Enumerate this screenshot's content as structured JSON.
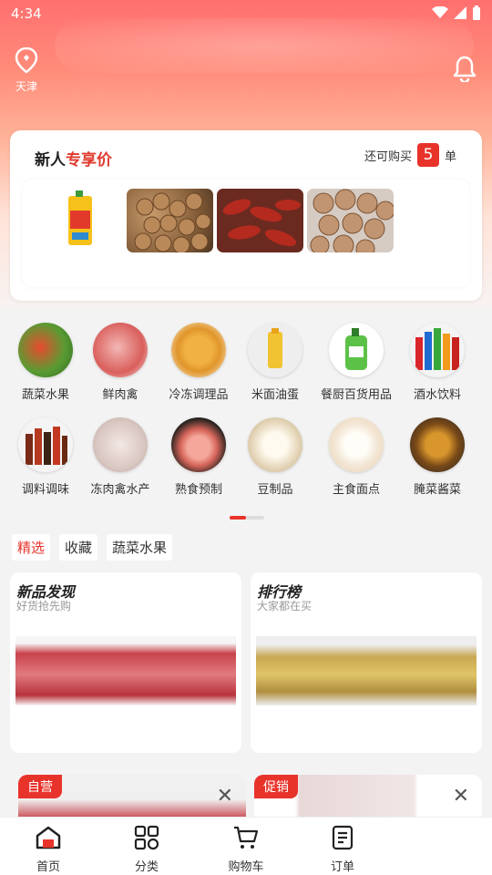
{
  "status": {
    "time": "4:34"
  },
  "header": {
    "location": "天津",
    "location_icon": "location-pin-icon",
    "bell_icon": "bell-icon"
  },
  "new_user": {
    "title_black": "新人",
    "title_red": "专享价",
    "remaining_prefix": "还可购买",
    "remaining_count": "5",
    "remaining_suffix": "单",
    "products": [
      "oil-jug",
      "dried-fruit",
      "red-chili",
      "walnut"
    ]
  },
  "categories": [
    {
      "label": "蔬菜水果"
    },
    {
      "label": "鲜肉禽"
    },
    {
      "label": "冷冻调理品"
    },
    {
      "label": "米面油蛋"
    },
    {
      "label": "餐厨百货用品"
    },
    {
      "label": "酒水饮料"
    },
    {
      "label": "调料调味"
    },
    {
      "label": "冻肉禽水产"
    },
    {
      "label": "熟食预制"
    },
    {
      "label": "豆制品"
    },
    {
      "label": "主食面点"
    },
    {
      "label": "腌菜酱菜"
    }
  ],
  "tabs": [
    {
      "label": "精选",
      "active": true
    },
    {
      "label": "收藏"
    },
    {
      "label": "蔬菜水果"
    }
  ],
  "features": [
    {
      "title": "新品发现",
      "subtitle": "好货抢先购"
    },
    {
      "title": "排行榜",
      "subtitle": "大家都在买"
    }
  ],
  "products": [
    {
      "badge": "自营",
      "close": "✕"
    },
    {
      "badge": "促销",
      "close": "✕"
    }
  ],
  "nav": [
    {
      "label": "首页",
      "icon": "home-icon"
    },
    {
      "label": "分类",
      "icon": "grid-icon"
    },
    {
      "label": "购物车",
      "icon": "cart-icon"
    },
    {
      "label": "订单",
      "icon": "order-icon"
    }
  ],
  "colors": {
    "accent": "#e8332b"
  }
}
